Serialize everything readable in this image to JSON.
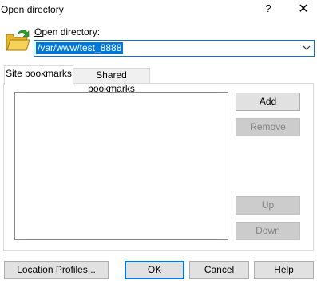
{
  "window": {
    "title": "Open directory",
    "help_glyph": "?",
    "close_glyph": "✕"
  },
  "directory": {
    "label_accel": "O",
    "label_rest": "pen directory:",
    "value": "/var/www/test_8888"
  },
  "tabs": [
    {
      "label": "Site bookmarks",
      "active": true
    },
    {
      "label": "Shared bookmarks",
      "active": false
    }
  ],
  "bookmarks": {
    "items": [],
    "buttons": {
      "add": "Add",
      "remove": "Remove",
      "up": "Up",
      "down": "Down"
    }
  },
  "footer": {
    "location_profiles": "Location Profiles...",
    "ok": "OK",
    "cancel": "Cancel",
    "help": "Help"
  },
  "colors": {
    "accent": "#0078d7",
    "folder": "#f4c542",
    "arrow": "#2aa02a"
  }
}
